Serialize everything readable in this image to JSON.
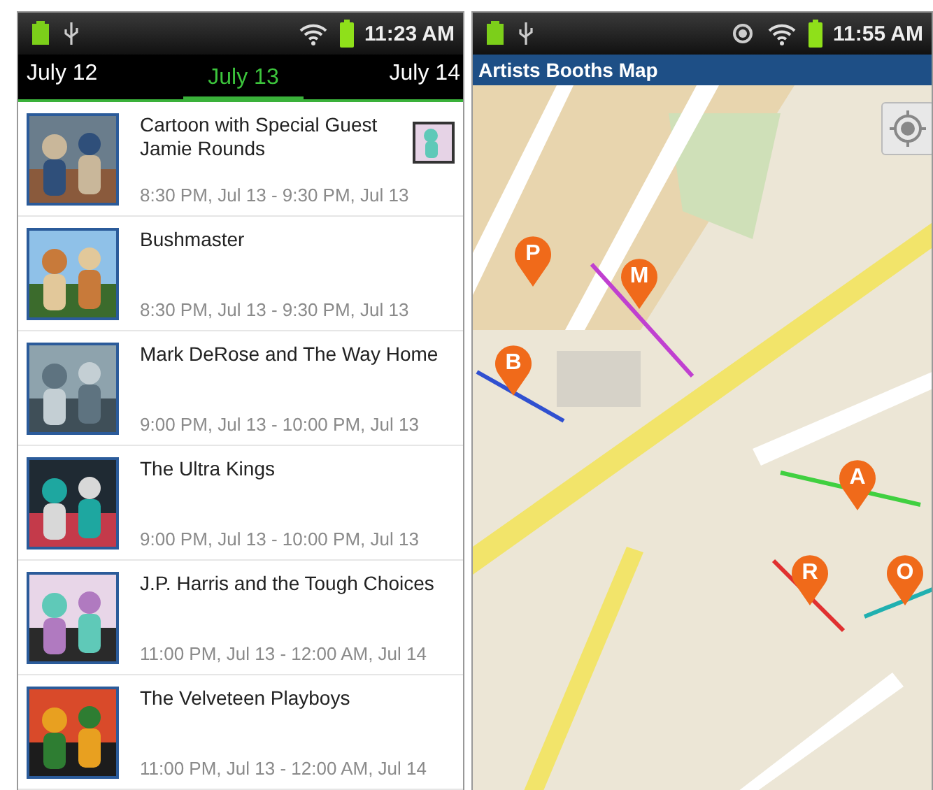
{
  "left_screen": {
    "status_bar": {
      "time": "11:23 AM",
      "gps": false
    },
    "tabs": [
      {
        "label": "July 12",
        "selected": false
      },
      {
        "label": "July 13",
        "selected": true
      },
      {
        "label": "July 14",
        "selected": false
      }
    ],
    "events": [
      {
        "title": "Cartoon with Special Guest Jamie Rounds",
        "time": "8:30 PM, Jul 13 - 9:30 PM, Jul 13",
        "attachment": true
      },
      {
        "title": "Bushmaster",
        "time": "8:30 PM, Jul 13 - 9:30 PM, Jul 13",
        "attachment": false
      },
      {
        "title": "Mark DeRose and The Way Home",
        "time": "9:00 PM, Jul 13 - 10:00 PM, Jul 13",
        "attachment": false
      },
      {
        "title": "The Ultra Kings",
        "time": "9:00 PM, Jul 13 - 10:00 PM, Jul 13",
        "attachment": false
      },
      {
        "title": "J.P. Harris and the Tough Choices",
        "time": "11:00 PM, Jul 13 - 12:00 AM, Jul 14",
        "attachment": false
      },
      {
        "title": "The Velveteen Playboys",
        "time": "11:00 PM, Jul 13 - 12:00 AM, Jul 14",
        "attachment": false
      }
    ]
  },
  "right_screen": {
    "status_bar": {
      "time": "11:55 AM",
      "gps": true
    },
    "title": "Artists Booths Map",
    "map": {
      "kind": "picture",
      "pins": [
        {
          "label": "P"
        },
        {
          "label": "M"
        },
        {
          "label": "B"
        },
        {
          "label": "A"
        },
        {
          "label": "R"
        },
        {
          "label": "O"
        }
      ]
    }
  }
}
